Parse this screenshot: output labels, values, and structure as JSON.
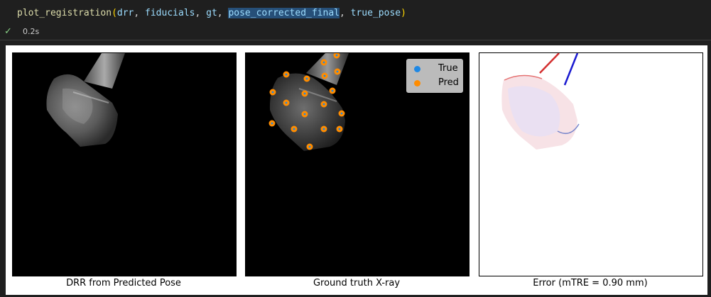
{
  "cell": {
    "code": {
      "fn": "plot_registration",
      "args": [
        "drr",
        "fiducials",
        "gt",
        "pose_corrected_final",
        "true_pose"
      ],
      "highlighted_arg": "pose_corrected_final"
    },
    "status_icon": "checkmark-icon",
    "elapsed": "0.2s"
  },
  "panels": [
    {
      "caption": "DRR from Predicted Pose"
    },
    {
      "caption": "Ground truth X-ray"
    },
    {
      "caption": "Error (mTRE = 0.90 mm)"
    }
  ],
  "legend": {
    "items": [
      {
        "label": "True",
        "color": "#1e88e5"
      },
      {
        "label": "Pred",
        "color": "#ff8c00"
      }
    ]
  },
  "colors": {
    "background": "#1f1f1f",
    "check": "#89d185",
    "true_marker": "#1e88e5",
    "pred_marker": "#ff8c00"
  }
}
